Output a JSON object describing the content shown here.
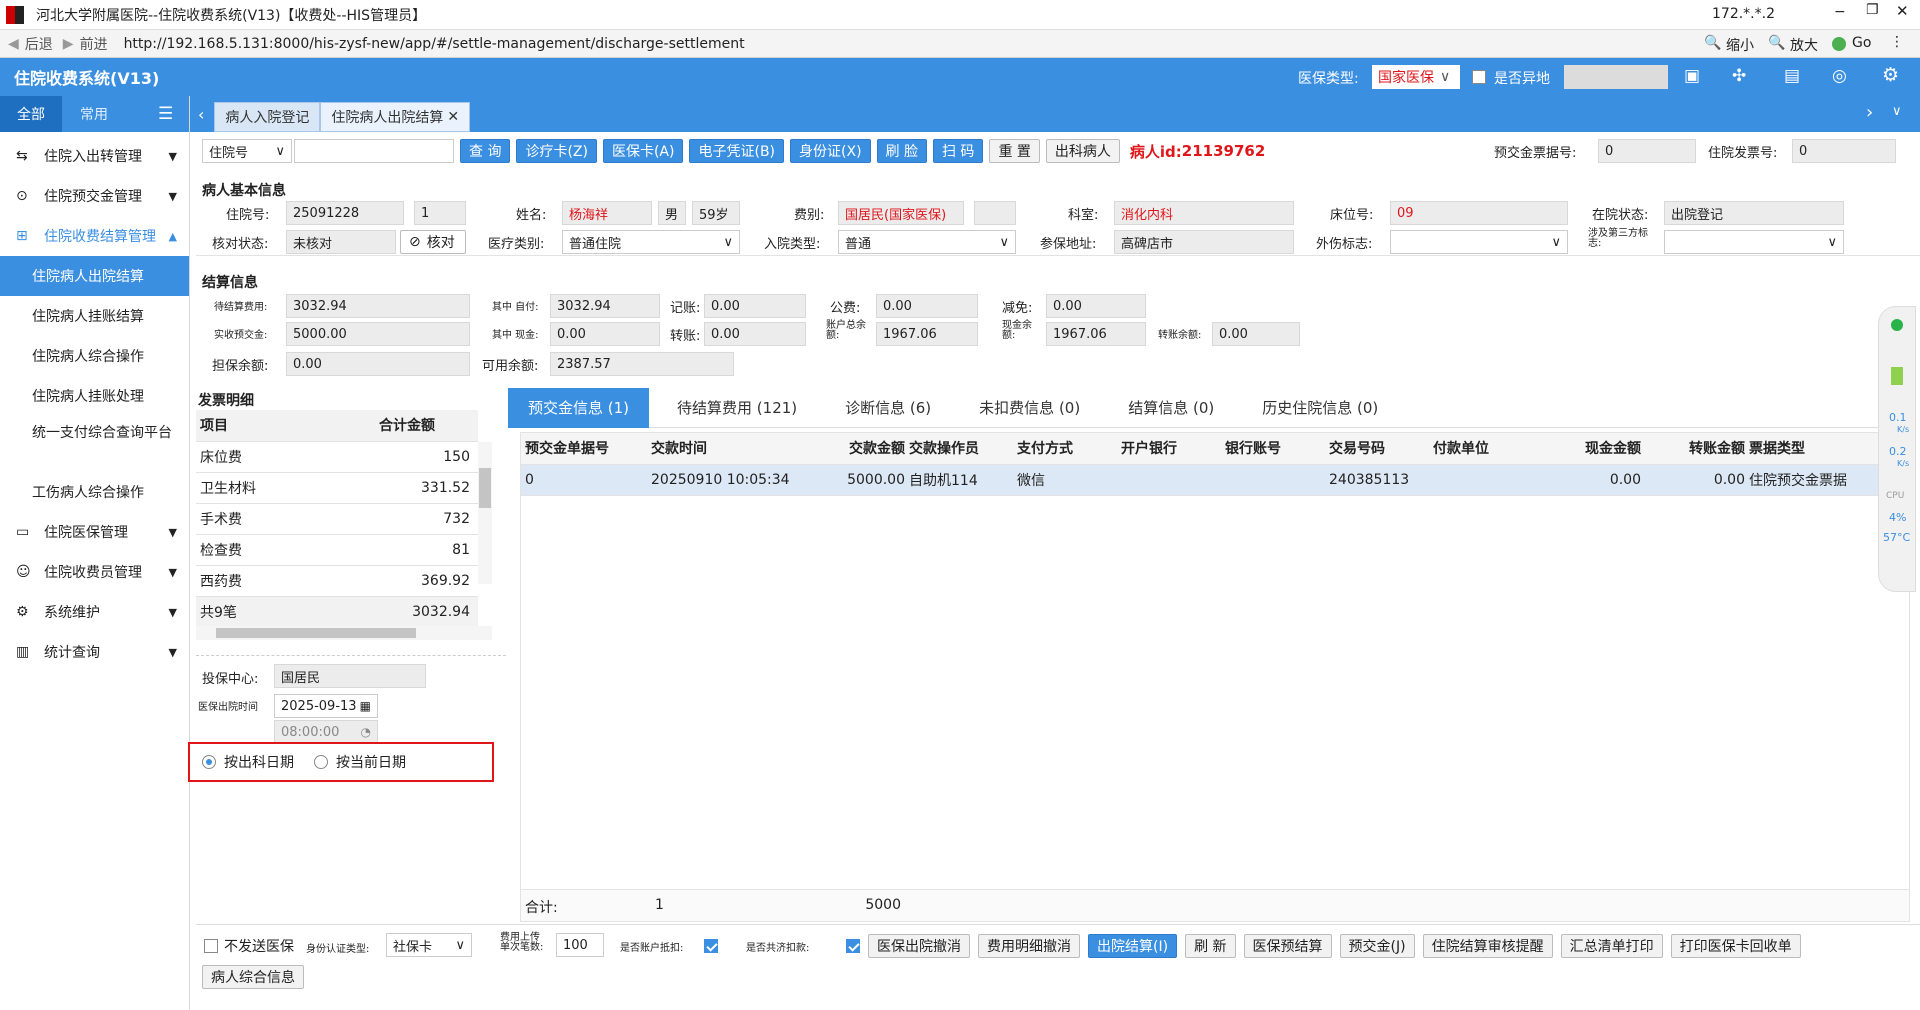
{
  "window": {
    "title": "河北大学附属医院--住院收费系统(V13)【收费处--HIS管理员】",
    "ip": "172.*.*.2"
  },
  "browser": {
    "back": "后退",
    "forward": "前进",
    "url": "http://192.168.5.131:8000/his-zysf-new/app/#/settle-management/discharge-settlement",
    "zoom_out": "缩小",
    "zoom_in": "放大",
    "go": "Go"
  },
  "app": {
    "title": "住院收费系统(V13)",
    "insurance_type_label": "医保类型:",
    "insurance_type_value": "国家医保",
    "remote_label": "是否异地"
  },
  "sidebar": {
    "tab_all": "全部",
    "tab_common": "常用",
    "groups": [
      {
        "label": "住院入出转管理"
      },
      {
        "label": "住院预交金管理"
      },
      {
        "label": "住院收费结算管理"
      }
    ],
    "subitems": [
      {
        "label": "住院病人出院结算"
      },
      {
        "label": "住院病人挂账结算"
      },
      {
        "label": "住院病人综合操作"
      },
      {
        "label": "住院病人挂账处理"
      },
      {
        "label": "统一支付综合查询平台"
      },
      {
        "label": "工伤病人综合操作"
      }
    ],
    "groups2": [
      {
        "label": "住院医保管理"
      },
      {
        "label": "住院收费员管理"
      },
      {
        "label": "系统维护"
      },
      {
        "label": "统计查询"
      }
    ]
  },
  "tabs": [
    {
      "label": "病人入院登记"
    },
    {
      "label": "住院病人出院结算"
    }
  ],
  "toolbar": {
    "search_type": "住院号",
    "query": "查 询",
    "card": "诊疗卡(Z)",
    "ins_card": "医保卡(A)",
    "e_voucher": "电子凭证(B)",
    "id_card": "身份证(X)",
    "face": "刷 脸",
    "scan": "扫 码",
    "reset": "重 置",
    "discharge": "出科病人",
    "patient_id_label": "病人id:",
    "patient_id": "21139762",
    "prepay_no_label": "预交金票据号:",
    "prepay_no": "0",
    "invoice_no_label": "住院发票号:",
    "invoice_no": "0"
  },
  "patient": {
    "section": "病人基本信息",
    "inp_no_label": "住院号:",
    "inp_no": "25091228",
    "times": "1",
    "name_label": "姓名:",
    "name": "杨海祥",
    "sex": "男",
    "age": "59岁",
    "fee_label": "费别:",
    "fee": "国居民(国家医保)",
    "dept_label": "科室:",
    "dept": "消化内科",
    "bed_label": "床位号:",
    "bed": "09",
    "status_label": "在院状态:",
    "status": "出院登记",
    "check_label": "核对状态:",
    "check": "未核对",
    "check_btn": "核对",
    "med_type_label": "医疗类别:",
    "med_type": "普通住院",
    "admit_type_label": "入院类型:",
    "admit_type": "普通",
    "ins_addr_label": "参保地址:",
    "ins_addr": "高碑店市",
    "injury_label": "外伤标志:",
    "third_label": "涉及第三方标志:"
  },
  "settle": {
    "section": "结算信息",
    "pending_label": "待结算费用:",
    "pending": "3032.94",
    "self_label": "其中 自付:",
    "self": "3032.94",
    "account_label": "记账:",
    "account": "0.00",
    "public_label": "公费:",
    "public": "0.00",
    "reduce_label": "减免:",
    "reduce": "0.00",
    "prepaid_label": "实收预交金:",
    "prepaid": "5000.00",
    "cash_label": "其中 现金:",
    "cash": "0.00",
    "transfer_label": "转账:",
    "transfer": "0.00",
    "acct_bal_label": "账户总余额:",
    "acct_bal": "1967.06",
    "cash_bal_label": "现金余额:",
    "cash_bal": "1967.06",
    "transfer_bal_label": "转账余额:",
    "transfer_bal": "0.00",
    "guarantee_label": "担保余额:",
    "guarantee": "0.00",
    "avail_label": "可用余额:",
    "avail": "2387.57"
  },
  "invoice": {
    "section": "发票明细",
    "col_item": "项目",
    "col_amount": "合计金额",
    "rows": [
      {
        "item": "床位费",
        "amount": "150"
      },
      {
        "item": "卫生材料",
        "amount": "331.52"
      },
      {
        "item": "手术费",
        "amount": "732"
      },
      {
        "item": "检查费",
        "amount": "81"
      },
      {
        "item": "西药费",
        "amount": "369.92"
      }
    ],
    "total_item": "共9笔",
    "total_amount": "3032.94"
  },
  "lower": {
    "center_label": "投保中心:",
    "center": "国居民",
    "discharge_time_label": "医保出院时间",
    "date": "2025-09-13",
    "time": "08:00:00",
    "radio1": "按出科日期",
    "radio2": "按当前日期"
  },
  "detail_tabs": [
    {
      "label": "预交金信息 (1)"
    },
    {
      "label": "待结算费用 (121)"
    },
    {
      "label": "诊断信息 (6)"
    },
    {
      "label": "未扣费信息 (0)"
    },
    {
      "label": "结算信息 (0)"
    },
    {
      "label": "历史住院信息 (0)"
    }
  ],
  "prepay_table": {
    "headers": [
      "预交金单据号",
      "交款时间",
      "交款金额",
      "交款操作员",
      "支付方式",
      "开户银行",
      "银行账号",
      "交易号码",
      "付款单位",
      "现金金额",
      "转账金额",
      "票据类型"
    ],
    "rows": [
      [
        "0",
        "20250910 10:05:34",
        "5000.00",
        "自助机114",
        "微信",
        "",
        "",
        "240385113",
        "",
        "0.00",
        "0.00",
        "住院预交金票据"
      ]
    ],
    "footer_label": "合计:",
    "footer_count": "1",
    "footer_amount": "5000"
  },
  "bottom": {
    "no_ins": "不发送医保",
    "id_type_label": "身份认证类型:",
    "id_type": "社保卡",
    "upload_label": "费用上传单次笔数:",
    "upload": "100",
    "acct_deduct_label": "是否账户抵扣:",
    "mutual_label": "是否共济扣款:",
    "btns": [
      "医保出院撤消",
      "费用明细撤消",
      "出院结算(I)",
      "刷 新",
      "医保预结算",
      "预交金(J)",
      "住院结算审核提醒",
      "汇总清单打印",
      "打印医保卡回收单"
    ],
    "patient_info": "病人综合信息"
  },
  "monitor": {
    "up": "0.1",
    "down": "0.2",
    "unit": "K/s",
    "cpu_label": "CPU",
    "cpu": "4%",
    "temp": "57°C"
  }
}
